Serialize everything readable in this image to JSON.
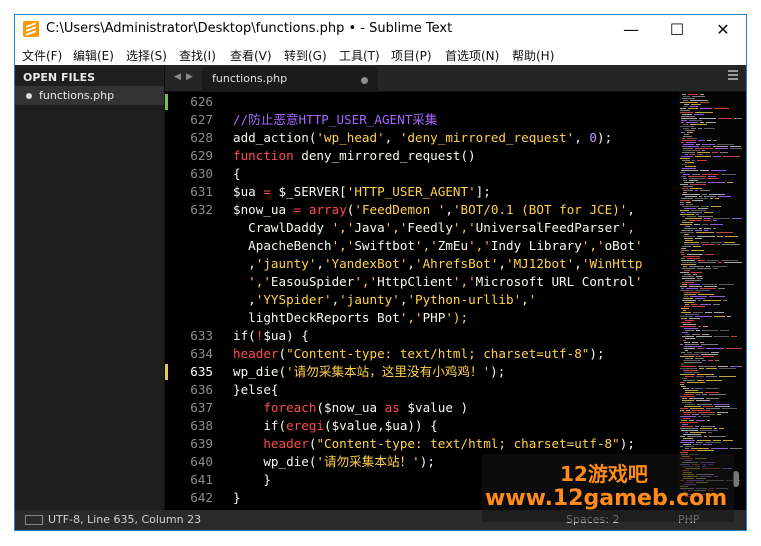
{
  "window": {
    "title": "C:\\Users\\Administrator\\Desktop\\functions.php • - Sublime Text",
    "controls": {
      "minimize": "—",
      "maximize": "☐",
      "close": "✕"
    }
  },
  "menu": [
    "文件(F)",
    "编辑(E)",
    "选择(S)",
    "查找(I)",
    "查看(V)",
    "转到(G)",
    "工具(T)",
    "项目(P)",
    "首选项(N)",
    "帮助(H)"
  ],
  "sidebar": {
    "header": "OPEN FILES",
    "files": [
      "functions.php"
    ]
  },
  "tabs": [
    {
      "label": "functions.php",
      "modified": true
    }
  ],
  "tab_arrows": {
    "left": "◀",
    "right": "▶"
  },
  "code_lines": [
    {
      "num": "626",
      "text": ""
    },
    {
      "num": "627",
      "text": "//防止恶意HTTP_USER_AGENT采集"
    },
    {
      "num": "628",
      "text": "add_action('wp_head', 'deny_mirrored_request', 0);"
    },
    {
      "num": "629",
      "text": "function deny_mirrored_request()"
    },
    {
      "num": "630",
      "text": "{"
    },
    {
      "num": "631",
      "text": "$ua = $_SERVER['HTTP_USER_AGENT'];"
    },
    {
      "num": "632",
      "text": "$now_ua = array('FeedDemon ','BOT/0.1 (BOT for JCE)',"
    },
    {
      "num": "",
      "text": "  CrawlDaddy ','Java','Feedly','UniversalFeedParser',"
    },
    {
      "num": "",
      "text": "  ApacheBench','Swiftbot','ZmEu','Indy Library','oBot'"
    },
    {
      "num": "",
      "text": "  ,'jaunty','YandexBot','AhrefsBot','MJ12bot','WinHttp"
    },
    {
      "num": "",
      "text": "  ','EasouSpider','HttpClient','Microsoft URL Control'"
    },
    {
      "num": "",
      "text": "  ,'YYSpider','jaunty','Python-urllib','"
    },
    {
      "num": "",
      "text": "  lightDeckReports Bot','PHP');"
    },
    {
      "num": "633",
      "text": "if(!$ua) {"
    },
    {
      "num": "634",
      "text": "header(\"Content-type: text/html; charset=utf-8\");"
    },
    {
      "num": "635",
      "text": "wp_die('请勿采集本站，这里没有小鸡鸡！');"
    },
    {
      "num": "636",
      "text": "}else{"
    },
    {
      "num": "637",
      "text": "    foreach($now_ua as $value )"
    },
    {
      "num": "638",
      "text": "    if(eregi($value,$ua)) {"
    },
    {
      "num": "639",
      "text": "    header(\"Content-type: text/html; charset=utf-8\");"
    },
    {
      "num": "640",
      "text": "    wp_die('请勿采集本站！');"
    },
    {
      "num": "641",
      "text": "    }"
    },
    {
      "num": "642",
      "text": "}"
    }
  ],
  "active_line": "635",
  "status": {
    "position": "UTF-8, Line 635, Column 23",
    "spaces": "Spaces: 2",
    "syntax": "PHP"
  },
  "watermark": {
    "title": "12游戏吧",
    "url": "www.12gameb.com"
  },
  "colors": {
    "comment": "#a566ff",
    "string": "#ffd24a",
    "keyword": "#ff4d4d",
    "number": "#c29cff",
    "window_border": "#2a7fc0",
    "watermark": "#ff8c1a"
  }
}
